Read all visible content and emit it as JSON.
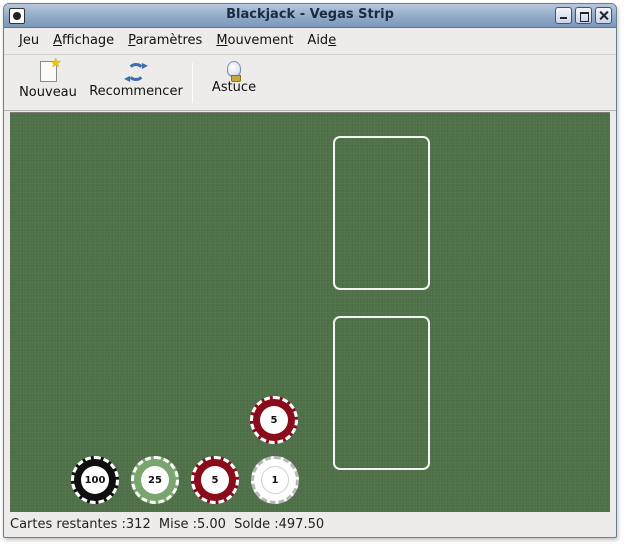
{
  "window": {
    "title": "Blackjack - Vegas Strip"
  },
  "menu": [
    {
      "mnemonic": "J",
      "rest": "eu"
    },
    {
      "mnemonic": "A",
      "rest": "ffichage"
    },
    {
      "mnemonic": "P",
      "rest": "aramètres"
    },
    {
      "mnemonic": "M",
      "rest": "ouvement"
    },
    {
      "mnemonic": "Aid",
      "rest": "e"
    }
  ],
  "toolbar": {
    "new_label": "Nouveau",
    "restart_label": "Recommencer",
    "hint_label": "Astuce"
  },
  "table": {
    "felt_color": "#4e7048",
    "bet_chip": {
      "value": "5",
      "color": "#8a0b1a"
    },
    "chips": [
      {
        "value": "100",
        "color": "#0f0f0f"
      },
      {
        "value": "25",
        "color": "#7aa56f"
      },
      {
        "value": "5",
        "color": "#8a0b1a"
      },
      {
        "value": "1",
        "color": "#ffffff"
      }
    ]
  },
  "status": {
    "cards_remaining": "Cartes restantes :312",
    "bet": "Mise :5.00",
    "balance": "Solde :497.50"
  }
}
